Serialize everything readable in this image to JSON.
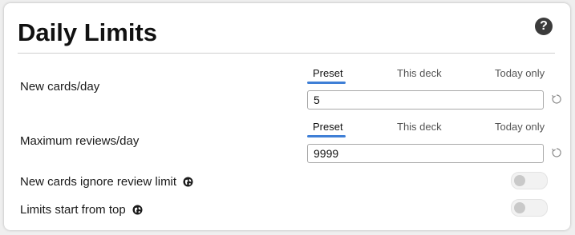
{
  "section": {
    "title": "Daily Limits",
    "help_icon": "question-circle-icon"
  },
  "new_cards": {
    "label": "New cards/day",
    "tabs": [
      "Preset",
      "This deck",
      "Today only"
    ],
    "active_tab": "Preset",
    "value": "5"
  },
  "max_reviews": {
    "label": "Maximum reviews/day",
    "tabs": [
      "Preset",
      "This deck",
      "Today only"
    ],
    "active_tab": "Preset",
    "value": "9999"
  },
  "toggles": {
    "ignore_review_limit": {
      "label": "New cards ignore review limit",
      "icon": "globe-icon",
      "enabled": false
    },
    "limits_start_from_top": {
      "label": "Limits start from top",
      "icon": "globe-icon",
      "enabled": false
    }
  },
  "colors": {
    "accent": "#3f7fd6",
    "text": "#111111",
    "toggle_off": "#c9c9c9"
  }
}
